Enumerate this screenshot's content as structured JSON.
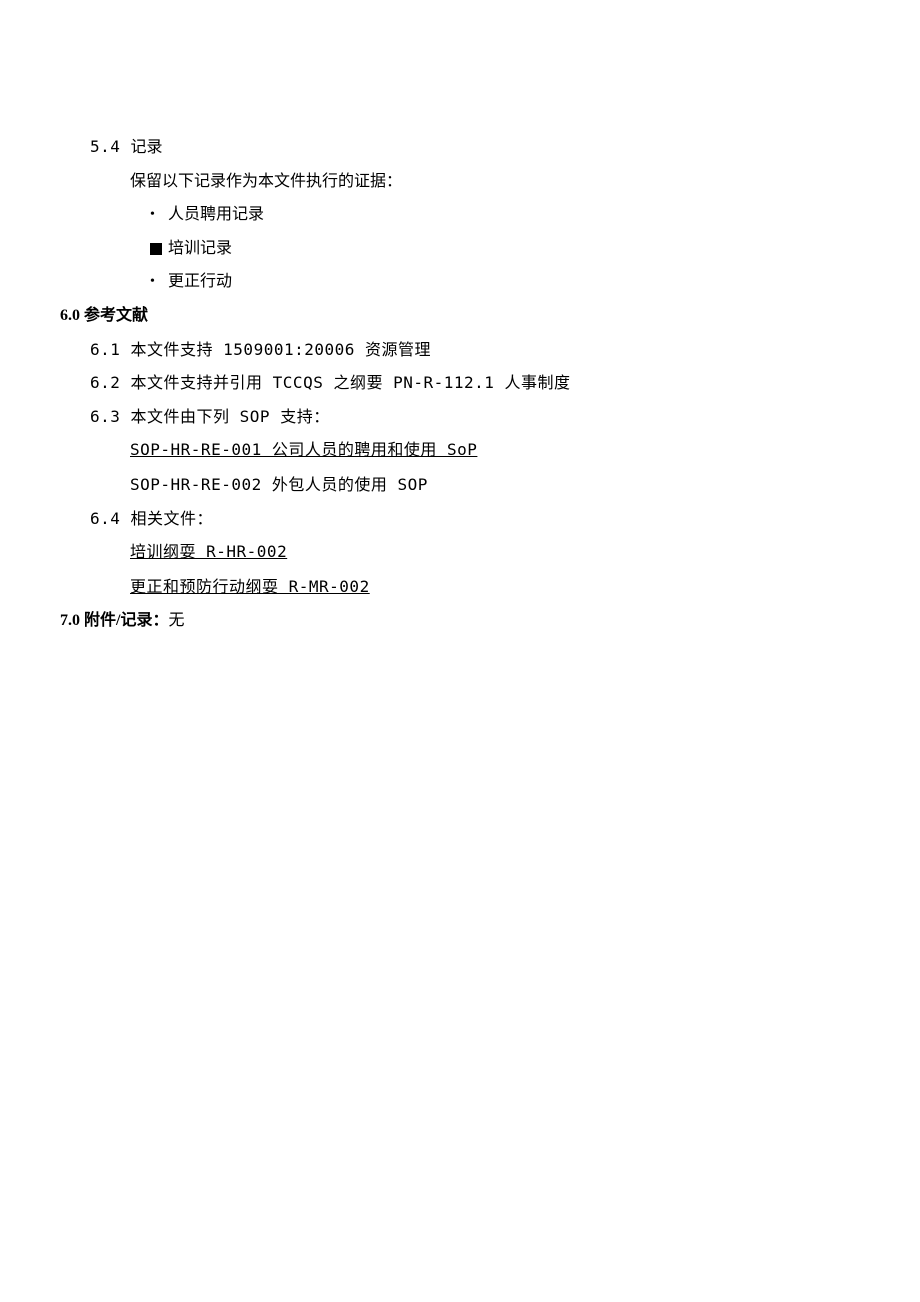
{
  "s5_4": {
    "num": "5.4 ",
    "title": "记录",
    "intro": "保留以下记录作为本文件执行的证据：",
    "b1": "人员聘用记录",
    "b2": "培训记录",
    "b3": "更正行动"
  },
  "s6": {
    "num": "6.0 ",
    "title": "参考文献",
    "i1": "6.1 本文件支持 1509001:20006 资源管理",
    "i2": "6.2 本文件支持并引用 TCCQS 之纲要 PN-R-112.1 人事制度",
    "i3": "6.3 本文件由下列 SOP 支持：",
    "i3a": "SOP-HR-RE-001 公司人员的聘用和使用 SoP",
    "i3b": "SOP-HR-RE-002 外包人员的使用 SOP",
    "i4": "6.4 相关文件：",
    "i4a": "培训纲耍 R-HR-002",
    "i4b": "更正和预防行动纲耍 R-MR-002"
  },
  "s7": {
    "num": "7.0 ",
    "title": "附件/记录：",
    "val": "无"
  }
}
